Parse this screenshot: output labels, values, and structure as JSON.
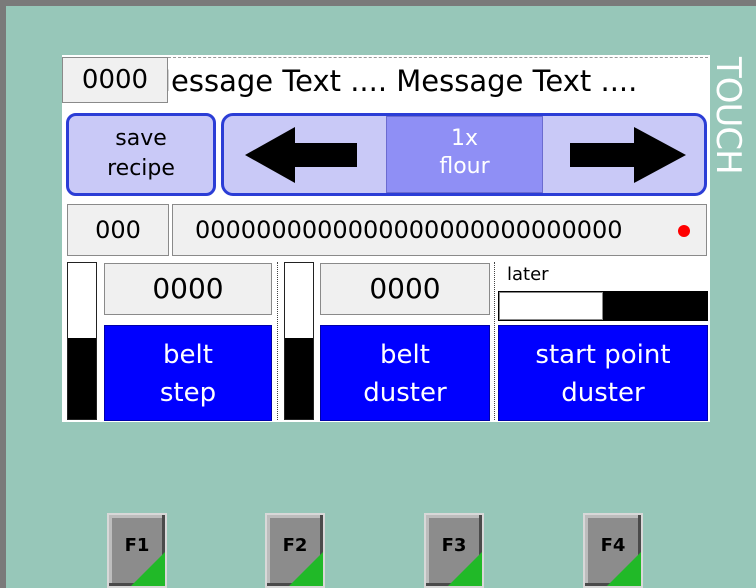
{
  "header": {
    "counter": "0000",
    "message": "Message Text .... Message Text ....",
    "side_label": "TOUCH"
  },
  "recipe": {
    "save_label_line1": "save",
    "save_label_line2": "recipe",
    "ingredient_line1": "1x",
    "ingredient_line2": "flour"
  },
  "codes": {
    "short": "000",
    "long": "0000000000000000000000000000"
  },
  "controls": {
    "belt_step": {
      "value": "0000",
      "label_line1": "belt",
      "label_line2": "step",
      "gauge_level": 0.52
    },
    "belt_duster": {
      "value": "0000",
      "label_line1": "belt",
      "label_line2": "duster",
      "gauge_level": 0.52
    },
    "start_point": {
      "later_label": "later",
      "progress": 0.5,
      "label_line1": "start point",
      "label_line2": "duster"
    }
  },
  "function_keys": [
    "F1",
    "F2",
    "F3",
    "F4"
  ],
  "colors": {
    "background": "#97c7b9",
    "button_blue": "#0000ff",
    "nav_fill": "#c9c9f7",
    "accent_green": "#21b928"
  }
}
